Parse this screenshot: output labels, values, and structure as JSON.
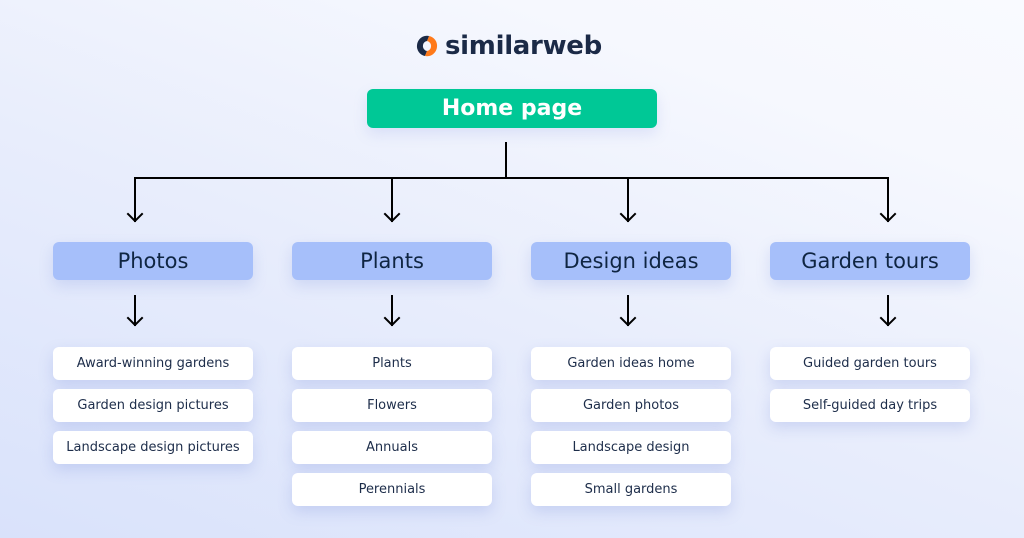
{
  "brand": {
    "name": "similarweb",
    "logo_icon": "similarweb-logo-icon",
    "colors": {
      "mark_orange": "#ff7a1a",
      "mark_navy": "#1b2a47"
    }
  },
  "root": {
    "label": "Home page",
    "color": "#00c896"
  },
  "categories": [
    {
      "label": "Photos",
      "items": [
        "Award-winning gardens",
        "Garden design pictures",
        "Landscape design pictures"
      ]
    },
    {
      "label": "Plants",
      "items": [
        "Plants",
        "Flowers",
        "Annuals",
        "Perennials"
      ]
    },
    {
      "label": "Design ideas",
      "items": [
        "Garden ideas home",
        "Garden photos",
        "Landscape design",
        "Small gardens"
      ]
    },
    {
      "label": "Garden tours",
      "items": [
        "Guided garden tours",
        "Self-guided day trips"
      ]
    }
  ],
  "colors": {
    "category_fill": "#a6bffa",
    "item_fill": "#ffffff",
    "connector": "#000000"
  }
}
